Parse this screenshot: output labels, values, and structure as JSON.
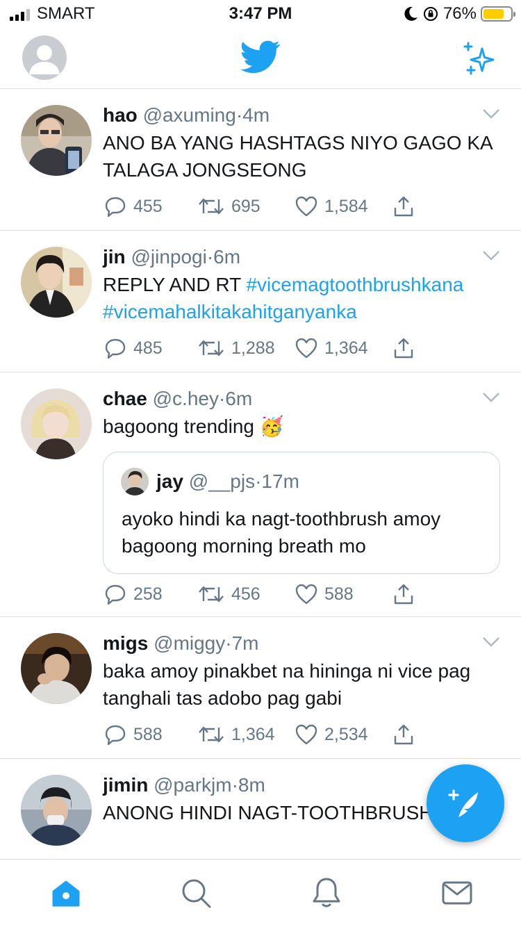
{
  "status_bar": {
    "carrier": "SMART",
    "time": "3:47 PM",
    "battery_percent": "76%",
    "battery_level": 0.76
  },
  "nav": {
    "profile_icon": "default-avatar-icon",
    "logo_icon": "twitter-bird-icon",
    "sparkle_icon": "sparkle-icon"
  },
  "tweets": [
    {
      "name": "hao",
      "handle": "@axuming",
      "time": "4m",
      "text": "ANO BA YANG HASHTAGS NIYO GAGO KA TALAGA JONGSEONG",
      "replies": "455",
      "retweets": "695",
      "likes": "1,584"
    },
    {
      "name": "jin",
      "handle": "@jinpogi",
      "time": "6m",
      "text": "REPLY AND RT",
      "hashtag1": "#vicemagtoothbrushkana",
      "hashtag2": "#vicemahalkitakahitganyanka",
      "replies": "485",
      "retweets": "1,288",
      "likes": "1,364"
    },
    {
      "name": "chae",
      "handle": "@c.hey",
      "time": "6m",
      "text": "bagoong trending",
      "emoji": "🥳",
      "quote": {
        "name": "jay",
        "handle": "@__pjs",
        "time": "17m",
        "text": "ayoko hindi ka nagt-toothbrush amoy bagoong morning breath mo"
      },
      "replies": "258",
      "retweets": "456",
      "likes": "588"
    },
    {
      "name": "migs",
      "handle": "@miggy",
      "time": "7m",
      "text": "baka amoy pinakbet na hininga ni vice pag tanghali tas adobo pag gabi",
      "replies": "588",
      "retweets": "1,364",
      "likes": "2,534"
    },
    {
      "name": "jimin",
      "handle": "@parkjm",
      "time": "8m",
      "text": "ANONG HINDI NAGT-TOOTHBRUSH VICE"
    }
  ],
  "dot": "·",
  "tabs": [
    "home-icon",
    "search-icon",
    "notifications-icon",
    "messages-icon"
  ],
  "colors": {
    "accent": "#1da1f2",
    "secondary_text": "#657786",
    "divider": "#d9dee2"
  }
}
